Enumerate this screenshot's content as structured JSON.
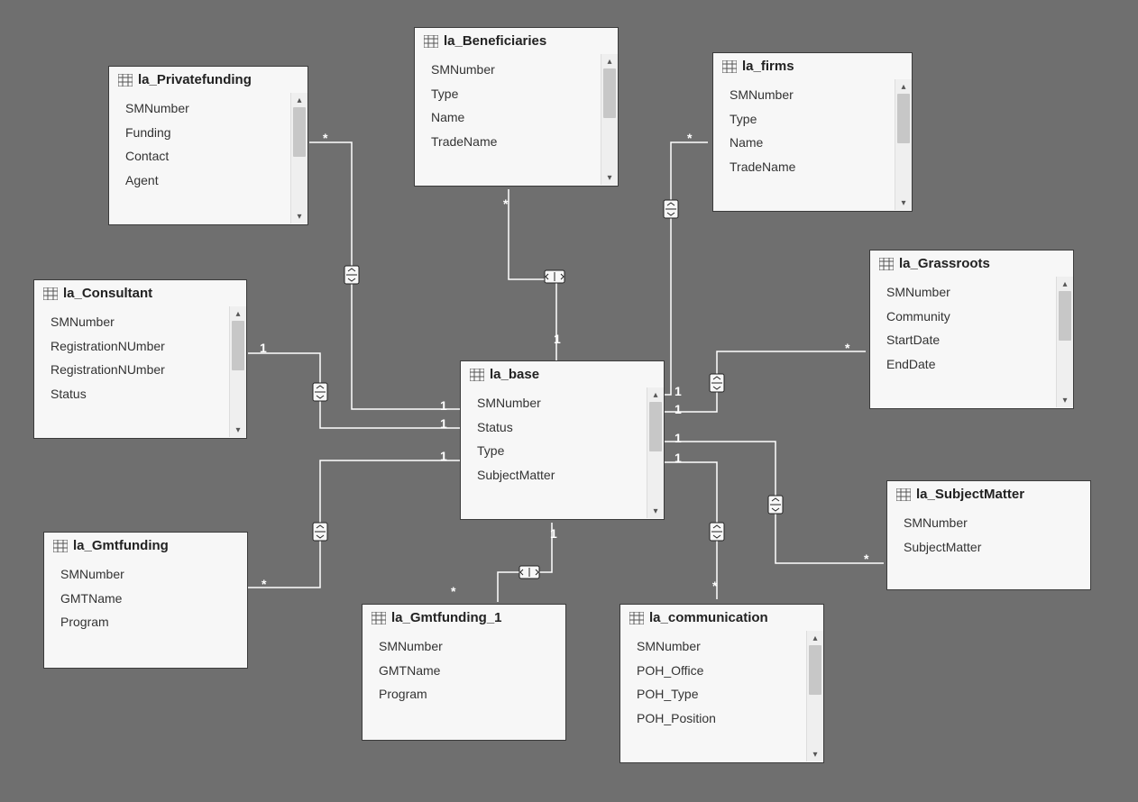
{
  "tables": {
    "privatefunding": {
      "title": "la_Privatefunding",
      "fields": [
        "SMNumber",
        "Funding",
        "Contact",
        "Agent"
      ],
      "scroll": true
    },
    "beneficiaries": {
      "title": "la_Beneficiaries",
      "fields": [
        "SMNumber",
        "Type",
        "Name",
        "TradeName"
      ],
      "scroll": true
    },
    "firms": {
      "title": "la_firms",
      "fields": [
        "SMNumber",
        "Type",
        "Name",
        "TradeName"
      ],
      "scroll": true
    },
    "consultant": {
      "title": "la_Consultant",
      "fields": [
        "SMNumber",
        "RegistrationNUmber",
        "RegistrationNUmber",
        "Status"
      ],
      "scroll": true
    },
    "base": {
      "title": "la_base",
      "fields": [
        "SMNumber",
        "Status",
        "Type",
        "SubjectMatter"
      ],
      "scroll": true
    },
    "grassroots": {
      "title": "la_Grassroots",
      "fields": [
        "SMNumber",
        "Community",
        "StartDate",
        "EndDate"
      ],
      "scroll": true
    },
    "gmtfunding": {
      "title": "la_Gmtfunding",
      "fields": [
        "SMNumber",
        "GMTName",
        "Program"
      ],
      "scroll": false
    },
    "gmtfunding1": {
      "title": "la_Gmtfunding_1",
      "fields": [
        "SMNumber",
        "GMTName",
        "Program"
      ],
      "scroll": false
    },
    "communication": {
      "title": "la_communication",
      "fields": [
        "SMNumber",
        "POH_Office",
        "POH_Type",
        "POH_Position"
      ],
      "scroll": true
    },
    "subjectmatter": {
      "title": "la_SubjectMatter",
      "fields": [
        "SMNumber",
        "SubjectMatter"
      ],
      "scroll": false
    }
  },
  "labels": {
    "one": "1",
    "many": "*"
  }
}
